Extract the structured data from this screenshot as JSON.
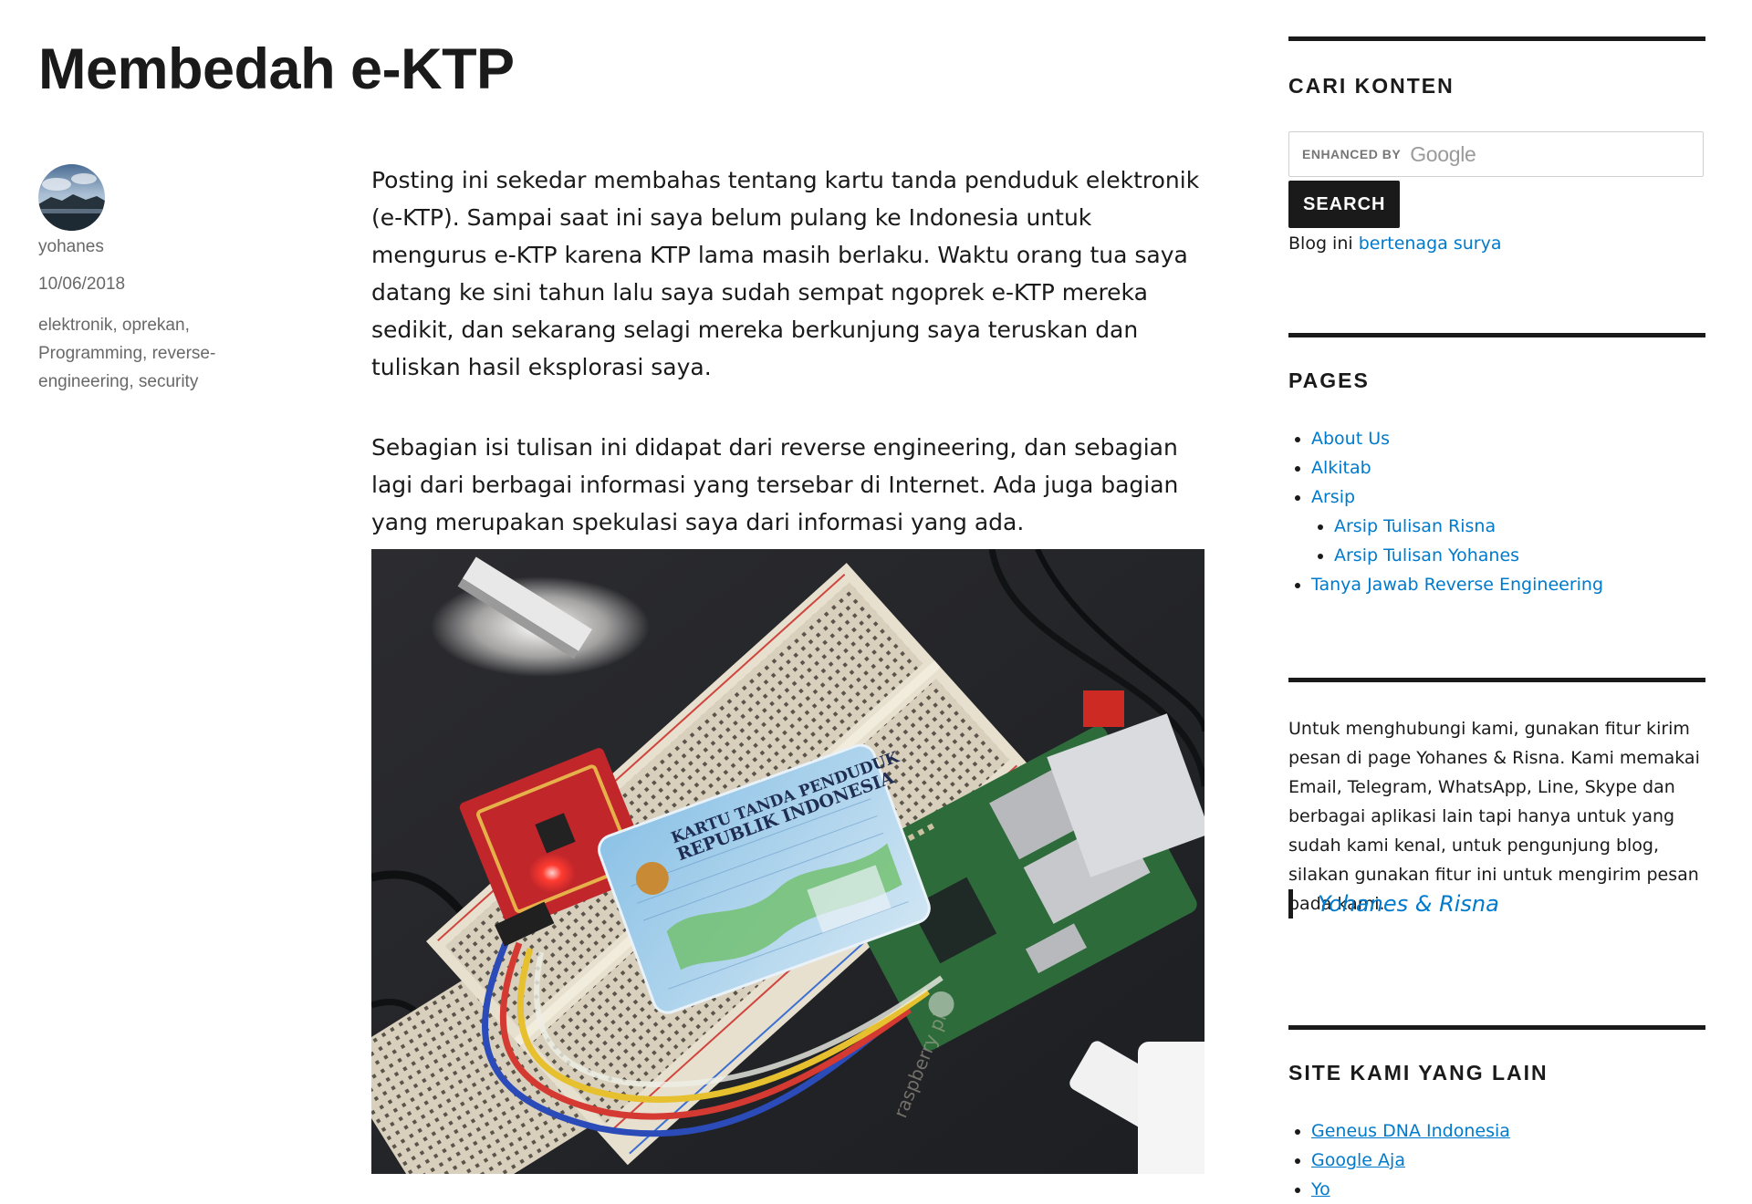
{
  "post": {
    "title": "Membedah e-KTP",
    "author": "yohanes",
    "date": "10/06/2018",
    "tags": [
      "elektronik",
      "oprekan",
      "Programming",
      "reverse-engineering",
      "security"
    ],
    "paragraphs": [
      "Posting ini sekedar membahas tentang kartu tanda penduduk elektronik (e-KTP). Sampai saat ini saya belum pulang ke Indonesia untuk mengurus e-KTP karena KTP lama masih berlaku. Waktu orang tua saya datang ke sini tahun lalu saya sudah sempat ngoprek e-KTP mereka sedikit, dan sekarang selagi mereka berkunjung saya teruskan dan tuliskan hasil eksplorasi saya.",
      "Sebagian isi tulisan ini didapat dari reverse engineering, dan sebagian lagi dari berbagai informasi yang tersebar di Internet. Ada juga bagian yang merupakan spekulasi saya dari informasi yang ada."
    ],
    "photo": {
      "card_line1": "KARTU TANDA PENDUDUK",
      "card_line2": "REPUBLIK INDONESIA",
      "board_text": "raspberry pi"
    }
  },
  "sidebar": {
    "search": {
      "title": "CARI KONTEN",
      "enhanced_by": "ENHANCED BY",
      "brand": "Google",
      "button": "SEARCH",
      "note_prefix": "Blog ini",
      "note_link": "bertenaga surya"
    },
    "pages": {
      "title": "PAGES",
      "items": [
        "About Us",
        "Alkitab",
        "Arsip",
        "Tanya Jawab Reverse Engineering"
      ],
      "arsip_children": [
        "Arsip Tulisan Risna",
        "Arsip Tulisan Yohanes"
      ]
    },
    "text_widget": {
      "body": "Untuk menghubungi kami, gunakan fitur kirim pesan di page Yohanes & Risna. Kami memakai Email, Telegram, WhatsApp, Line, Skype dan berbagai aplikasi lain tapi hanya untuk yang sudah kami kenal, untuk pengunjung blog, silakan gunakan fitur ini untuk mengirim pesan pada kami.",
      "link": "Yohanes & Risna"
    },
    "sites": {
      "title": "SITE KAMI YANG LAIN",
      "items": [
        "Geneus DNA Indonesia",
        "Google Aja",
        "Yo"
      ]
    }
  },
  "colors": {
    "text": "#1a1a1a",
    "meta": "#686868",
    "link": "#007acc",
    "rule": "#1a1a1a",
    "button_bg": "#1a1a1a"
  }
}
